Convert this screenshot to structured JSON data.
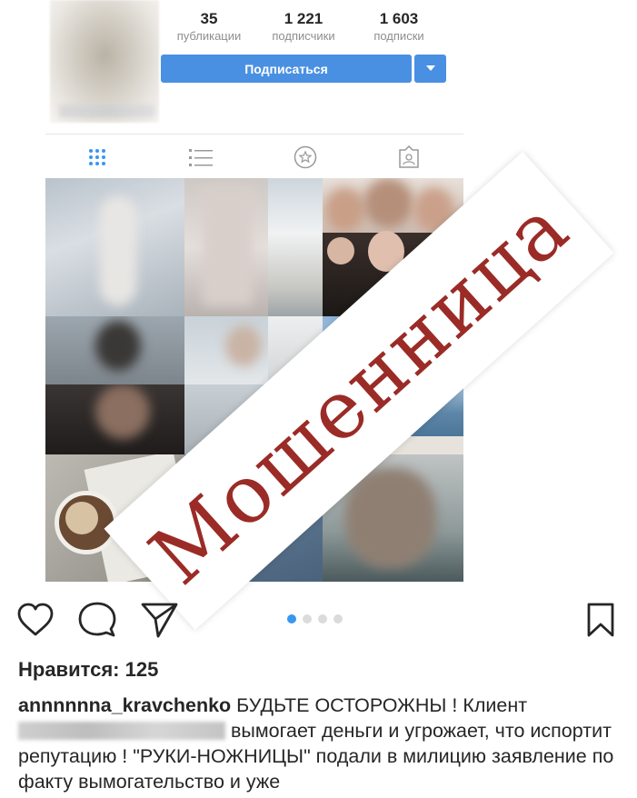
{
  "profile": {
    "stats": [
      {
        "value": "35",
        "label": "публикации"
      },
      {
        "value": "1 221",
        "label": "подписчики"
      },
      {
        "value": "1 603",
        "label": "подписки"
      }
    ],
    "follow_button": "Подписаться"
  },
  "profile_tabs": [
    {
      "icon": "grid-icon",
      "active": true
    },
    {
      "icon": "list-icon",
      "active": false
    },
    {
      "icon": "saved-star-icon",
      "active": false
    },
    {
      "icon": "tagged-icon",
      "active": false
    }
  ],
  "overlay": {
    "stamp_text": "Мошенница",
    "stamp_color": "#9b2b26"
  },
  "post": {
    "carousel": {
      "count": 4,
      "active_index": 0
    },
    "likes": "Нравится: 125",
    "caption": {
      "username": "annnnnna_kravchenko",
      "text_part1": "БУДЬТЕ ОСТОРОЖНЫ ! Клиент",
      "text_part2": "вымогает деньги и угрожает, что испортит репутацию ! \"РУКИ-НОЖНИЦЫ\" подали в милицию заявление по факту вымогательство и уже"
    }
  },
  "colors": {
    "accent": "#3897f0",
    "button": "#4a90e2",
    "text": "#262626",
    "muted": "#8e8e8e"
  }
}
